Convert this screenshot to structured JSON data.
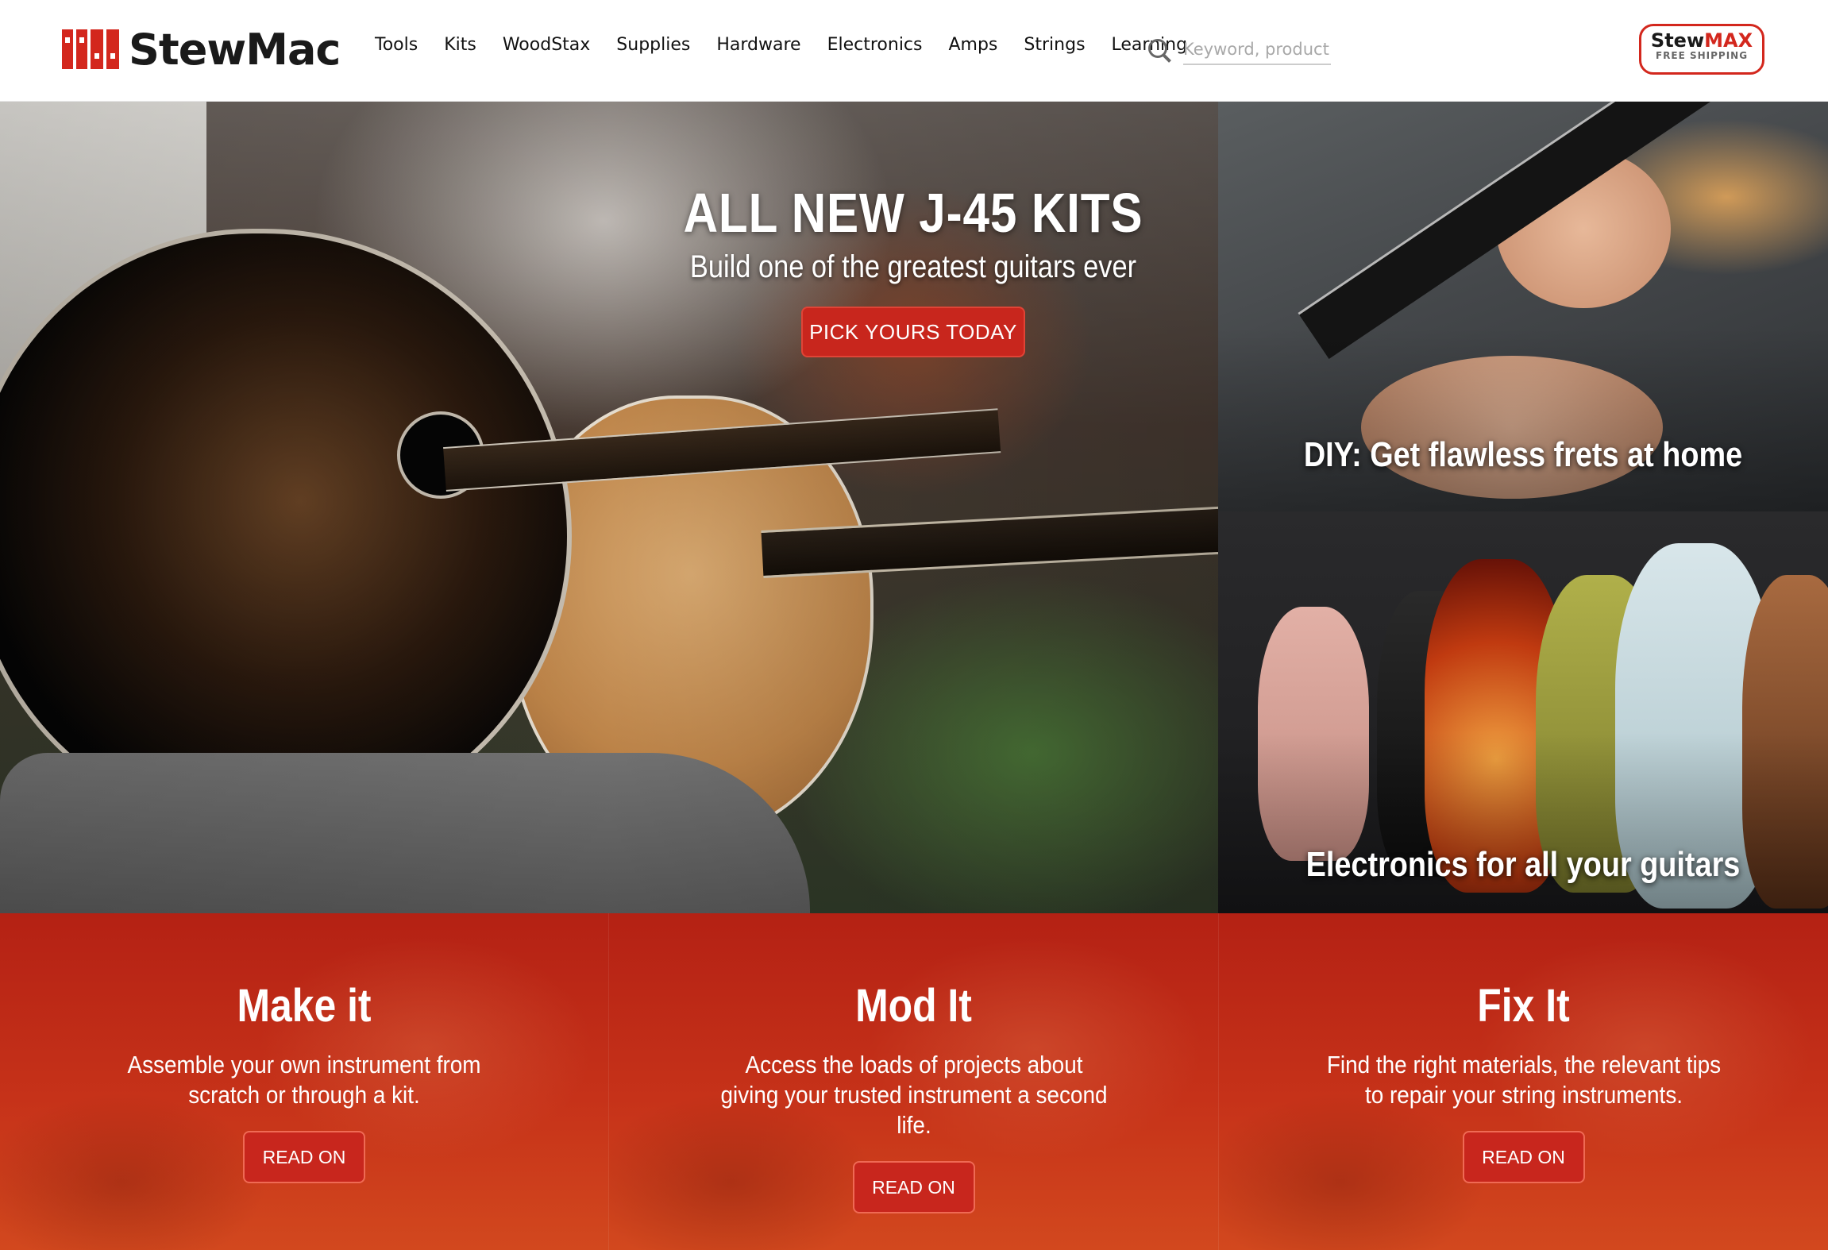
{
  "header": {
    "logo_text": "StewMac",
    "nav": [
      "Tools",
      "Kits",
      "WoodStax",
      "Supplies",
      "Hardware",
      "Electronics",
      "Amps",
      "Strings",
      "Learning"
    ],
    "search_placeholder": "Keyword, product #",
    "stewmax_title_a": "Stew",
    "stewmax_title_b": "MAX",
    "stewmax_sub": "FREE SHIPPING"
  },
  "hero": {
    "title": "ALL NEW J-45 KITS",
    "subtitle": "Build one of the greatest guitars ever",
    "button": "PICK YOURS TODAY"
  },
  "tiles": [
    {
      "caption": "DIY: Get flawless frets at home"
    },
    {
      "caption": "Electronics for all your guitars"
    }
  ],
  "panels": [
    {
      "title": "Make it",
      "desc": "Assemble your own instrument from scratch or through a kit.",
      "button": "READ ON"
    },
    {
      "title": "Mod It",
      "desc": "Access the loads of projects about giving your trusted instrument a second life.",
      "button": "READ ON"
    },
    {
      "title": "Fix It",
      "desc": "Find the right materials, the relevant tips to repair your string instruments.",
      "button": "READ ON"
    }
  ],
  "colors": {
    "brand_red": "#d3271d",
    "button_red": "#c8261d"
  }
}
